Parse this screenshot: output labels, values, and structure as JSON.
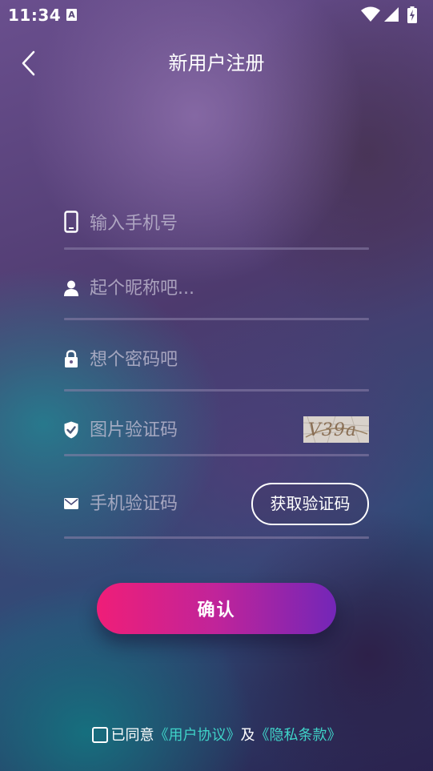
{
  "status_bar": {
    "time": "11:34",
    "notification_icon_letter": "A",
    "icons": [
      "wifi-icon",
      "signal-icon",
      "battery-charging-icon"
    ]
  },
  "header": {
    "title": "新用户注册",
    "back_icon": "chevron-left-icon"
  },
  "form": {
    "phone": {
      "placeholder": "输入手机号",
      "value": "",
      "icon": "phone-icon"
    },
    "nickname": {
      "placeholder": "起个昵称吧...",
      "value": "",
      "icon": "user-icon"
    },
    "password": {
      "placeholder": "想个密码吧",
      "value": "",
      "icon": "lock-icon"
    },
    "captcha": {
      "placeholder": "图片验证码",
      "value": "",
      "icon": "shield-check-icon",
      "image_text": "V39a"
    },
    "sms_code": {
      "placeholder": "手机验证码",
      "value": "",
      "icon": "mail-icon",
      "button_label": "获取验证码"
    }
  },
  "confirm_label": "确认",
  "agreement": {
    "prefix": "已同意",
    "user_agreement": "《用户协议》",
    "conjunction": "及",
    "privacy": "《隐私条款》",
    "checked": false
  },
  "colors": {
    "link": "#3fd3c8",
    "button_gradient_start": "#ef1e78",
    "button_gradient_end": "#7326b8"
  }
}
